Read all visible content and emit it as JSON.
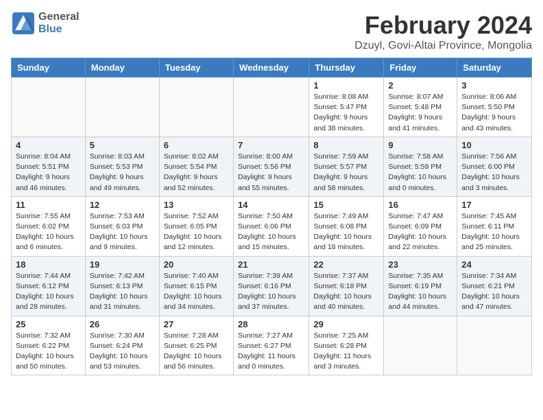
{
  "header": {
    "logo_general": "General",
    "logo_blue": "Blue",
    "month_title": "February 2024",
    "location": "Dzuyl, Govi-Altai Province, Mongolia"
  },
  "days_of_week": [
    "Sunday",
    "Monday",
    "Tuesday",
    "Wednesday",
    "Thursday",
    "Friday",
    "Saturday"
  ],
  "weeks": [
    [
      {
        "day": "",
        "info": ""
      },
      {
        "day": "",
        "info": ""
      },
      {
        "day": "",
        "info": ""
      },
      {
        "day": "",
        "info": ""
      },
      {
        "day": "1",
        "info": "Sunrise: 8:08 AM\nSunset: 5:47 PM\nDaylight: 9 hours\nand 38 minutes."
      },
      {
        "day": "2",
        "info": "Sunrise: 8:07 AM\nSunset: 5:48 PM\nDaylight: 9 hours\nand 41 minutes."
      },
      {
        "day": "3",
        "info": "Sunrise: 8:06 AM\nSunset: 5:50 PM\nDaylight: 9 hours\nand 43 minutes."
      }
    ],
    [
      {
        "day": "4",
        "info": "Sunrise: 8:04 AM\nSunset: 5:51 PM\nDaylight: 9 hours\nand 46 minutes."
      },
      {
        "day": "5",
        "info": "Sunrise: 8:03 AM\nSunset: 5:53 PM\nDaylight: 9 hours\nand 49 minutes."
      },
      {
        "day": "6",
        "info": "Sunrise: 8:02 AM\nSunset: 5:54 PM\nDaylight: 9 hours\nand 52 minutes."
      },
      {
        "day": "7",
        "info": "Sunrise: 8:00 AM\nSunset: 5:56 PM\nDaylight: 9 hours\nand 55 minutes."
      },
      {
        "day": "8",
        "info": "Sunrise: 7:59 AM\nSunset: 5:57 PM\nDaylight: 9 hours\nand 58 minutes."
      },
      {
        "day": "9",
        "info": "Sunrise: 7:58 AM\nSunset: 5:59 PM\nDaylight: 10 hours\nand 0 minutes."
      },
      {
        "day": "10",
        "info": "Sunrise: 7:56 AM\nSunset: 6:00 PM\nDaylight: 10 hours\nand 3 minutes."
      }
    ],
    [
      {
        "day": "11",
        "info": "Sunrise: 7:55 AM\nSunset: 6:02 PM\nDaylight: 10 hours\nand 6 minutes."
      },
      {
        "day": "12",
        "info": "Sunrise: 7:53 AM\nSunset: 6:03 PM\nDaylight: 10 hours\nand 9 minutes."
      },
      {
        "day": "13",
        "info": "Sunrise: 7:52 AM\nSunset: 6:05 PM\nDaylight: 10 hours\nand 12 minutes."
      },
      {
        "day": "14",
        "info": "Sunrise: 7:50 AM\nSunset: 6:06 PM\nDaylight: 10 hours\nand 15 minutes."
      },
      {
        "day": "15",
        "info": "Sunrise: 7:49 AM\nSunset: 6:08 PM\nDaylight: 10 hours\nand 18 minutes."
      },
      {
        "day": "16",
        "info": "Sunrise: 7:47 AM\nSunset: 6:09 PM\nDaylight: 10 hours\nand 22 minutes."
      },
      {
        "day": "17",
        "info": "Sunrise: 7:45 AM\nSunset: 6:11 PM\nDaylight: 10 hours\nand 25 minutes."
      }
    ],
    [
      {
        "day": "18",
        "info": "Sunrise: 7:44 AM\nSunset: 6:12 PM\nDaylight: 10 hours\nand 28 minutes."
      },
      {
        "day": "19",
        "info": "Sunrise: 7:42 AM\nSunset: 6:13 PM\nDaylight: 10 hours\nand 31 minutes."
      },
      {
        "day": "20",
        "info": "Sunrise: 7:40 AM\nSunset: 6:15 PM\nDaylight: 10 hours\nand 34 minutes."
      },
      {
        "day": "21",
        "info": "Sunrise: 7:39 AM\nSunset: 6:16 PM\nDaylight: 10 hours\nand 37 minutes."
      },
      {
        "day": "22",
        "info": "Sunrise: 7:37 AM\nSunset: 6:18 PM\nDaylight: 10 hours\nand 40 minutes."
      },
      {
        "day": "23",
        "info": "Sunrise: 7:35 AM\nSunset: 6:19 PM\nDaylight: 10 hours\nand 44 minutes."
      },
      {
        "day": "24",
        "info": "Sunrise: 7:34 AM\nSunset: 6:21 PM\nDaylight: 10 hours\nand 47 minutes."
      }
    ],
    [
      {
        "day": "25",
        "info": "Sunrise: 7:32 AM\nSunset: 6:22 PM\nDaylight: 10 hours\nand 50 minutes."
      },
      {
        "day": "26",
        "info": "Sunrise: 7:30 AM\nSunset: 6:24 PM\nDaylight: 10 hours\nand 53 minutes."
      },
      {
        "day": "27",
        "info": "Sunrise: 7:28 AM\nSunset: 6:25 PM\nDaylight: 10 hours\nand 56 minutes."
      },
      {
        "day": "28",
        "info": "Sunrise: 7:27 AM\nSunset: 6:27 PM\nDaylight: 11 hours\nand 0 minutes."
      },
      {
        "day": "29",
        "info": "Sunrise: 7:25 AM\nSunset: 6:28 PM\nDaylight: 11 hours\nand 3 minutes."
      },
      {
        "day": "",
        "info": ""
      },
      {
        "day": "",
        "info": ""
      }
    ]
  ]
}
